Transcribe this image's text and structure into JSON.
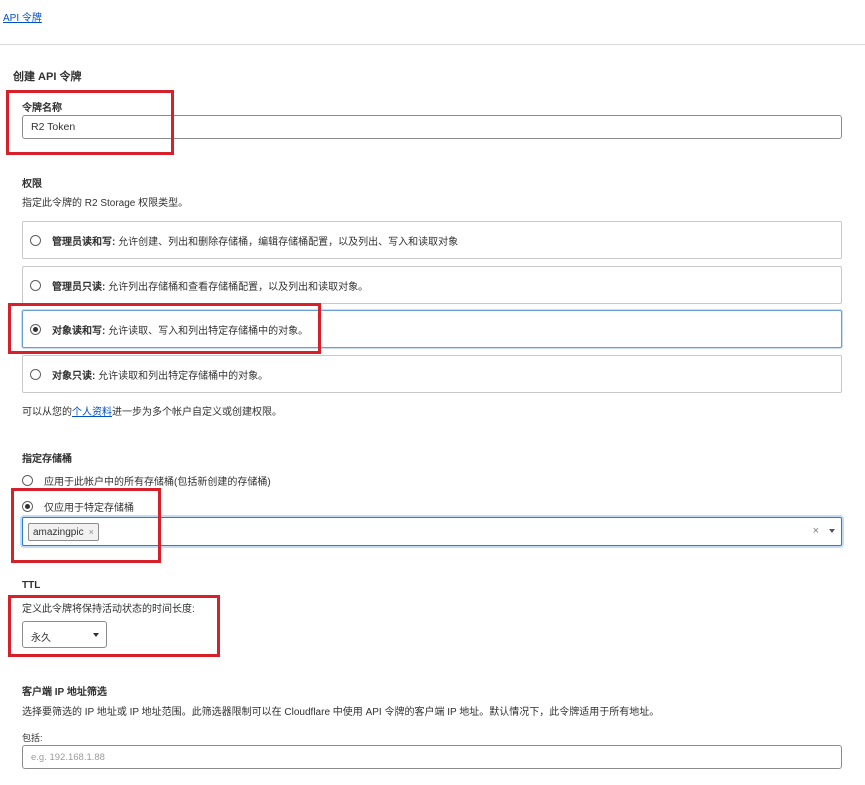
{
  "breadcrumb": {
    "link": "API 令牌"
  },
  "page": {
    "title": "创建 API 令牌"
  },
  "token_name": {
    "label": "令牌名称",
    "value": "R2 Token"
  },
  "permissions": {
    "label": "权限",
    "description": "指定此令牌的 R2 Storage 权限类型。",
    "options": [
      {
        "title": "管理员读和写:",
        "desc": " 允许创建、列出和删除存储桶，编辑存储桶配置，以及列出、写入和读取对象",
        "checked": false
      },
      {
        "title": "管理员只读:",
        "desc": " 允许列出存储桶和查看存储桶配置，以及列出和读取对象。",
        "checked": false
      },
      {
        "title": "对象读和写:",
        "desc": " 允许读取、写入和列出特定存储桶中的对象。",
        "checked": true
      },
      {
        "title": "对象只读:",
        "desc": " 允许读取和列出特定存储桶中的对象。",
        "checked": false
      }
    ],
    "footnote_prefix": "可以从您的",
    "footnote_link": "个人资料",
    "footnote_suffix": "进一步为多个帐户自定义或创建权限。"
  },
  "buckets": {
    "label": "指定存储桶",
    "options": [
      {
        "label": "应用于此帐户中的所有存储桶(包括新创建的存储桶)",
        "checked": false
      },
      {
        "label": "仅应用于特定存储桶",
        "checked": true
      }
    ],
    "selected_tags": [
      {
        "label": "amazingpic",
        "remove": "×"
      }
    ],
    "clear_glyph": "×"
  },
  "ttl": {
    "label": "TTL",
    "description": "定义此令牌将保持活动状态的时间长度:",
    "selected": "永久"
  },
  "ip_filter": {
    "label": "客户端 IP 地址筛选",
    "description": "选择要筛选的 IP 地址或 IP 地址范围。此筛选器限制可以在 Cloudflare 中使用 API 令牌的客户端 IP 地址。默认情况下，此令牌适用于所有地址。",
    "include_label": "包括:",
    "include_placeholder": "e.g. 192.168.1.88"
  },
  "colors": {
    "link": "#0051c3",
    "annotation": "#d8202a",
    "focus": "#2c7cd1"
  }
}
